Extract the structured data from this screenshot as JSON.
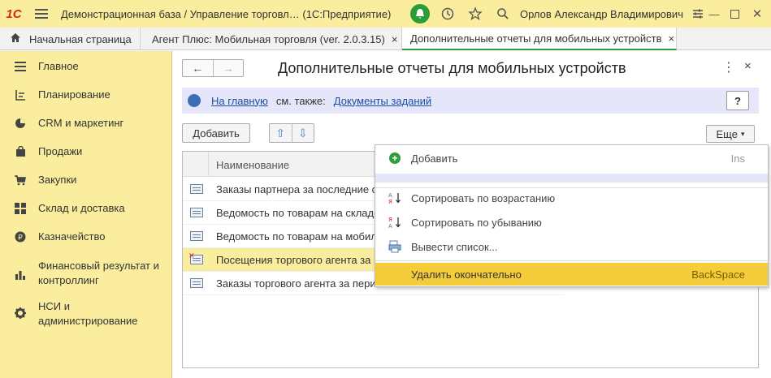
{
  "titlebar": {
    "logo": "1С",
    "title": "Демонстрационная база / Управление торговл…  (1С:Предприятие)",
    "user": "Орлов Александр Владимирович"
  },
  "tabs": [
    {
      "label": "Начальная страница"
    },
    {
      "label": "Агент Плюс: Мобильная торговля (ver. 2.0.3.15)",
      "close": "×"
    },
    {
      "label": "Дополнительные отчеты для мобильных устройств",
      "close": "×"
    }
  ],
  "sidebar": {
    "items": [
      {
        "label": "Главное",
        "icon": "menu-icon"
      },
      {
        "label": "Планирование",
        "icon": "planning-icon"
      },
      {
        "label": "CRM и маркетинг",
        "icon": "pie-icon"
      },
      {
        "label": "Продажи",
        "icon": "bag-icon"
      },
      {
        "label": "Закупки",
        "icon": "cart-icon"
      },
      {
        "label": "Склад и доставка",
        "icon": "grid-icon"
      },
      {
        "label": "Казначейство",
        "icon": "coin-icon"
      },
      {
        "label": "Финансовый результат и контроллинг",
        "icon": "bar-chart-icon"
      },
      {
        "label": "НСИ и администрирование",
        "icon": "gear-icon"
      }
    ]
  },
  "main": {
    "title": "Дополнительные отчеты для мобильных устройств",
    "nav_back": "←",
    "nav_forward": "→",
    "kebab": "⋮",
    "close": "×",
    "infobar": {
      "home_link": "На главную",
      "see_also": "см. также:",
      "tasks_link": "Документы заданий",
      "help": "?"
    },
    "toolbar": {
      "add_label": "Добавить",
      "up": "⇧",
      "down": "⇩",
      "more_label": "Еще",
      "more_arrow": "▾"
    },
    "table": {
      "header": "Наименование",
      "rows": [
        {
          "name": "Заказы партнера за последние с"
        },
        {
          "name": "Ведомость по товарам на складе"
        },
        {
          "name": "Ведомость по товарам на мобил"
        },
        {
          "name": "Посещения торгового агента за"
        },
        {
          "name": "Заказы торгового агента за пери"
        }
      ]
    }
  },
  "menu": {
    "items": [
      {
        "label": "Добавить",
        "shortcut": "Ins"
      },
      {
        "label": "Сортировать по возрастанию",
        "shortcut": ""
      },
      {
        "label": "Сортировать по убыванию",
        "shortcut": ""
      },
      {
        "label": "Вывести список...",
        "shortcut": ""
      },
      {
        "label": "Удалить окончательно",
        "shortcut": "BackSpace"
      }
    ]
  },
  "colors": {
    "accent_yellow": "#fbed9e",
    "highlight": "#f5cd3a",
    "green": "#2a9d3a",
    "link": "#1a4fa8",
    "info_bg": "#e6e6fb"
  }
}
